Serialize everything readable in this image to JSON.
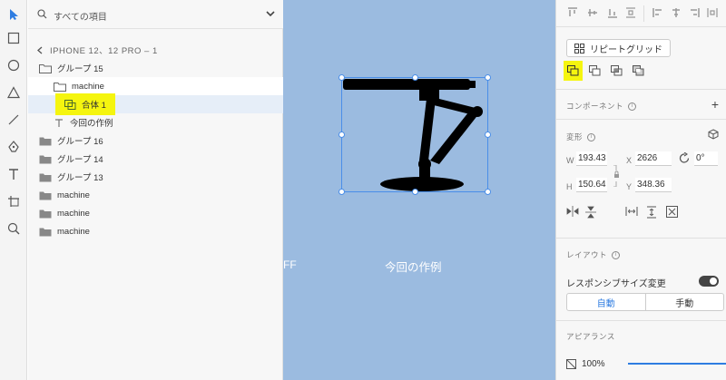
{
  "layers_panel": {
    "search_text": "すべての項目",
    "breadcrumb": "IPHONE 12、12 PRO – 1",
    "items": [
      {
        "label": "グループ 15",
        "type": "folder"
      },
      {
        "label": "machine",
        "type": "folder-open"
      },
      {
        "label": "合体 1",
        "type": "combined"
      },
      {
        "label": "今回の作例",
        "type": "text"
      },
      {
        "label": "グループ 16",
        "type": "folder"
      },
      {
        "label": "グループ 14",
        "type": "folder"
      },
      {
        "label": "グループ 13",
        "type": "folder"
      },
      {
        "label": "machine",
        "type": "folder"
      },
      {
        "label": "machine",
        "type": "folder"
      },
      {
        "label": "machine",
        "type": "folder"
      }
    ]
  },
  "canvas": {
    "cut_text": "FF",
    "artboard_text": "今回の作例",
    "background": "#9bbbe0",
    "selection_color": "#4a8ee8"
  },
  "properties": {
    "repeat_grid_label": "リピートグリッド",
    "component_title": "コンポーネント",
    "transform_title": "変形",
    "w_label": "W",
    "w_value": "193.43",
    "x_label": "X",
    "x_value": "2626",
    "rotation_value": "0°",
    "h_label": "H",
    "h_value": "150.64",
    "y_label": "Y",
    "y_value": "348.36",
    "layout_title": "レイアウト",
    "responsive_label": "レスポンシブサイズ変更",
    "auto_label": "自動",
    "manual_label": "手動",
    "appearance_title": "アピアランス",
    "opacity_value": "100%"
  },
  "colors": {
    "highlight": "#f5f50f",
    "accent": "#2f7de1"
  }
}
